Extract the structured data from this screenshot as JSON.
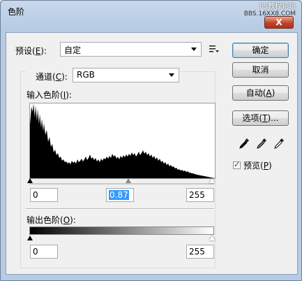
{
  "window": {
    "title": "色阶",
    "close_label": "X",
    "watermark": [
      "PS教程论坛",
      "BBS.16XX8.COM"
    ]
  },
  "preset": {
    "label_prefix": "预设(",
    "label_key": "E",
    "label_suffix": "):",
    "value": "自定",
    "options_icon": "list-options-icon"
  },
  "channel": {
    "label_prefix": "通道(",
    "label_key": "C",
    "label_suffix": "):",
    "value": "RGB"
  },
  "input_levels": {
    "label_prefix": "输入色阶(",
    "label_key": "I",
    "label_suffix": "):",
    "black": "0",
    "gamma": "0.87",
    "white": "255"
  },
  "output_levels": {
    "label_prefix": "输出色阶(",
    "label_key": "O",
    "label_suffix": "):",
    "black": "0",
    "white": "255"
  },
  "buttons": {
    "ok": "确定",
    "cancel": "取消",
    "auto_prefix": "自动(",
    "auto_key": "A",
    "auto_suffix": ")",
    "options_prefix": "选项(",
    "options_key": "T",
    "options_suffix": ")..."
  },
  "preview": {
    "label_prefix": "预览(",
    "label_key": "P",
    "label_suffix": ")",
    "checked": true
  },
  "eyedroppers": [
    "black-eyedropper-icon",
    "gray-eyedropper-icon",
    "white-eyedropper-icon"
  ]
}
